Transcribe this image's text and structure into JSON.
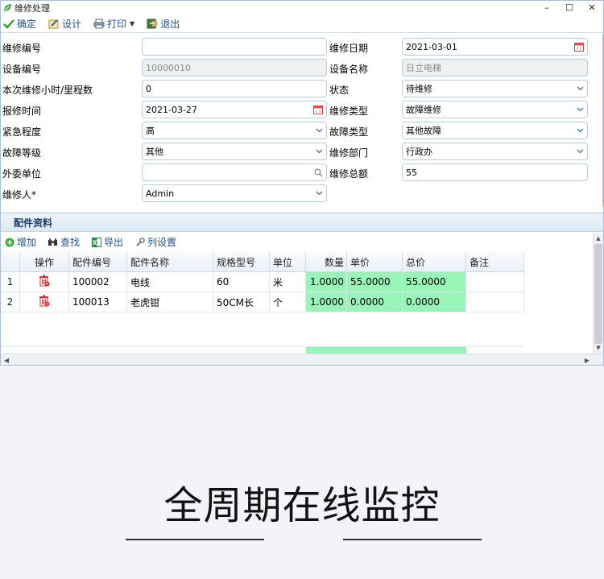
{
  "window": {
    "title": "维修处理",
    "minimize_glyph": "–",
    "maximize_glyph": "☐",
    "close_glyph": "✕"
  },
  "toolbar": {
    "items": [
      {
        "label": "确定",
        "icon": "check-icon"
      },
      {
        "label": "设计",
        "icon": "design-icon"
      },
      {
        "label": "打印",
        "icon": "printer-icon",
        "has_dropdown": true
      },
      {
        "label": "退出",
        "icon": "exit-icon"
      }
    ]
  },
  "form": {
    "repair_no": {
      "label": "维修编号",
      "value": ""
    },
    "repair_date": {
      "label": "维修日期",
      "value": "2021-03-01"
    },
    "equipment_no": {
      "label": "设备编号",
      "value": "10000010"
    },
    "equipment_name": {
      "label": "设备名称",
      "value": "日立电梯"
    },
    "hours": {
      "label": "本次维修小时/里程数",
      "value": "0"
    },
    "status": {
      "label": "状态",
      "value": "待维修"
    },
    "report_time": {
      "label": "报修时间",
      "value": "2021-03-27"
    },
    "repair_type": {
      "label": "维修类型",
      "value": "故障维修"
    },
    "urgency": {
      "label": "紧急程度",
      "value": "高"
    },
    "fault_type": {
      "label": "故障类型",
      "value": "其他故障"
    },
    "fault_level": {
      "label": "故障等级",
      "value": "其他"
    },
    "department": {
      "label": "维修部门",
      "value": "行政办"
    },
    "outsource": {
      "label": "外委单位",
      "value": ""
    },
    "total": {
      "label": "维修总额",
      "value": "55"
    },
    "repairer": {
      "label": "维修人*",
      "value": "Admin"
    }
  },
  "parts_section": {
    "title": "配件资料"
  },
  "grid_toolbar": {
    "items": [
      {
        "label": "增加",
        "icon": "add-icon"
      },
      {
        "label": "查找",
        "icon": "binoculars-icon"
      },
      {
        "label": "导出",
        "icon": "excel-icon"
      },
      {
        "label": "列设置",
        "icon": "wrench-icon"
      }
    ]
  },
  "parts_table": {
    "columns": [
      "操作",
      "配件编号",
      "配件名称",
      "规格型号",
      "单位",
      "数量",
      "单价",
      "总价",
      "备注"
    ],
    "rows": [
      {
        "no": "1",
        "code": "100002",
        "name": "电线",
        "spec": "60",
        "unit": "米",
        "qty": "1.0000",
        "price": "55.0000",
        "total": "55.0000",
        "note": ""
      },
      {
        "no": "2",
        "code": "100013",
        "name": "老虎钳",
        "spec": "50CM长",
        "unit": "个",
        "qty": "1.0000",
        "price": "0.0000",
        "total": "0.0000",
        "note": ""
      }
    ]
  },
  "banner": {
    "slogan": "全周期在线监控"
  },
  "colors": {
    "accent": "#1d4f91",
    "highlight": "#99f5b7",
    "border": "#a9bfd6"
  }
}
